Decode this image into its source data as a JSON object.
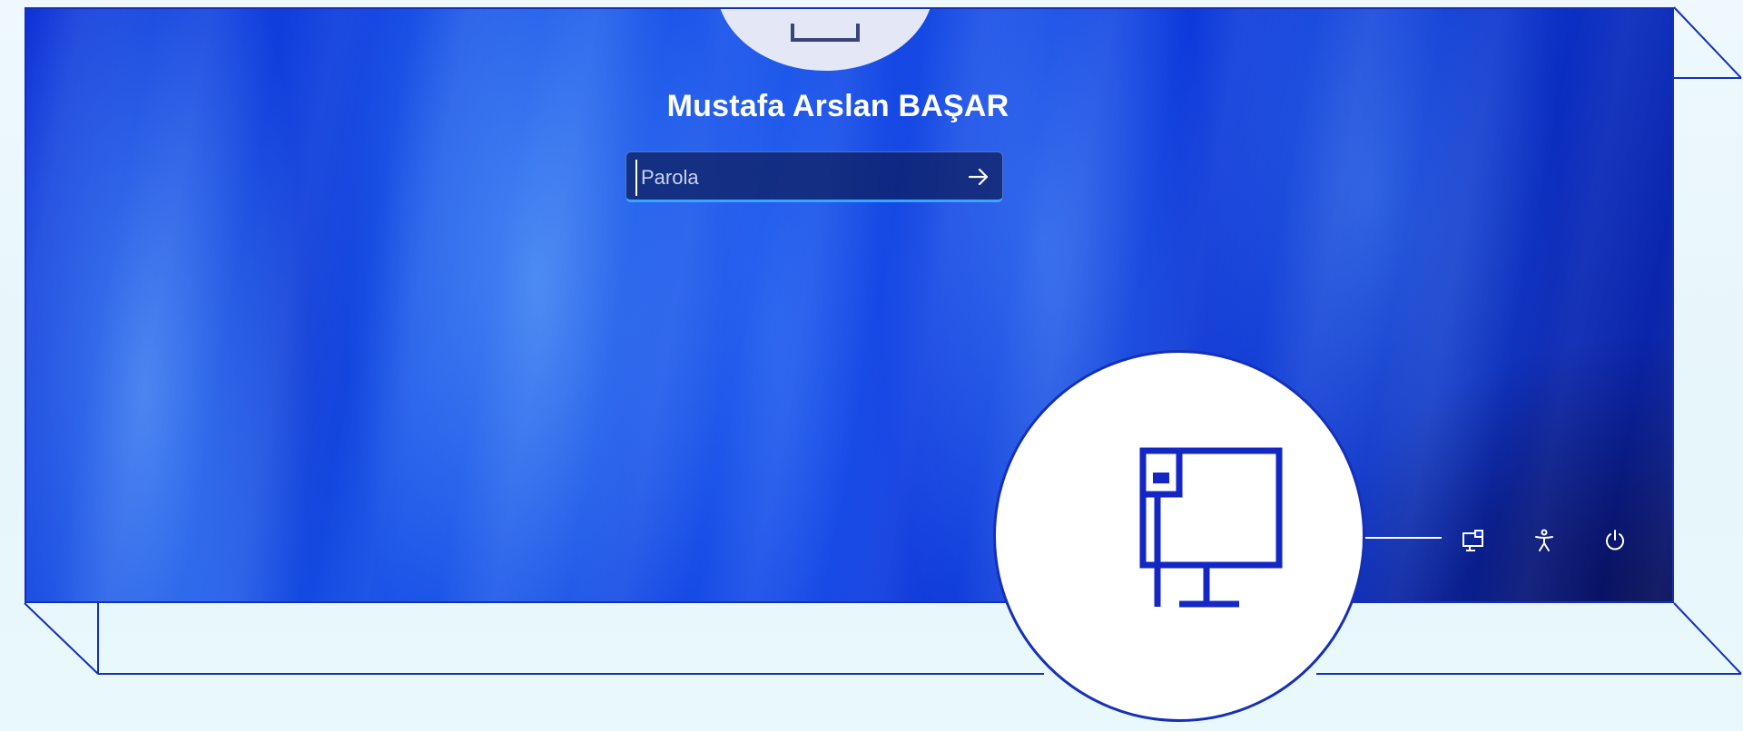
{
  "user": {
    "name": "Mustafa Arslan BAŞAR"
  },
  "password": {
    "placeholder": "Parola",
    "value": "",
    "submit_icon": "arrow-right-icon"
  },
  "corner_icons": [
    {
      "name": "other-user-monitor-icon"
    },
    {
      "name": "accessibility-icon"
    },
    {
      "name": "power-icon"
    }
  ],
  "magnifier": {
    "icon": "other-user-monitor-icon"
  },
  "colors": {
    "frame": "#1530b8",
    "accent": "#35a7ff",
    "background": "#e6f6fb",
    "wallpaper_primary": "#0d3be0"
  }
}
